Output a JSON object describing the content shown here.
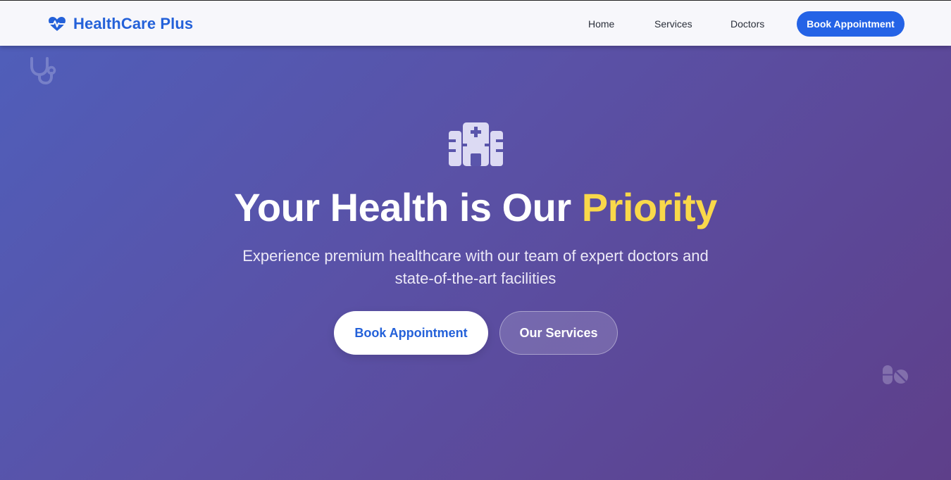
{
  "header": {
    "brand_name": "HealthCare Plus",
    "brand_icon": "heart-pulse-icon",
    "nav": [
      {
        "label": "Home"
      },
      {
        "label": "Services"
      },
      {
        "label": "Doctors"
      }
    ],
    "cta_label": "Book Appointment"
  },
  "hero": {
    "icon": "hospital-icon",
    "title_main": "Your Health is Our ",
    "title_accent": "Priority",
    "subtitle_line1": "Experience premium healthcare with our team of expert doctors and",
    "subtitle_line2": "state-of-the-art facilities",
    "primary_button": "Book Appointment",
    "secondary_button": "Our Services"
  },
  "decorations": [
    "stethoscope-icon",
    "pills-icon"
  ],
  "colors": {
    "brand": "#2461d9",
    "accent": "#f9d84a",
    "hero_gradient_start": "#4f5fbb",
    "hero_gradient_end": "#5e3f8a"
  }
}
